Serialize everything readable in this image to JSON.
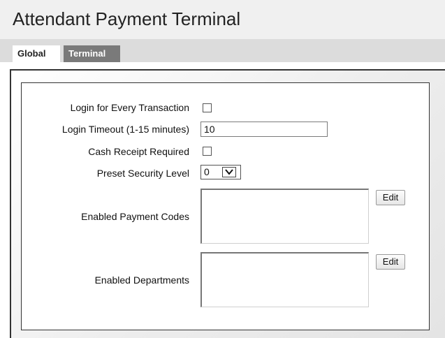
{
  "app": {
    "title": "Attendant Payment Terminal"
  },
  "tabs": [
    {
      "label": "Global",
      "active": true
    },
    {
      "label": "Terminal",
      "active": false
    }
  ],
  "form": {
    "login_every_transaction": {
      "label": "Login for Every Transaction",
      "checked": false
    },
    "login_timeout": {
      "label": "Login Timeout (1-15 minutes)",
      "value": "10"
    },
    "cash_receipt_required": {
      "label": "Cash Receipt Required",
      "checked": false
    },
    "preset_security_level": {
      "label": "Preset Security Level",
      "value": "0"
    },
    "enabled_payment_codes": {
      "label": "Enabled Payment Codes",
      "edit_label": "Edit",
      "items": []
    },
    "enabled_departments": {
      "label": "Enabled Departments",
      "edit_label": "Edit",
      "items": []
    }
  },
  "colors": {
    "header_bg": "#f0f0f0",
    "tabbar_bg": "#dcdcdc",
    "inactive_tab_bg": "#7a7a7a",
    "border": "#333333"
  },
  "icons": {
    "select_arrow": "chevron-down-icon"
  }
}
